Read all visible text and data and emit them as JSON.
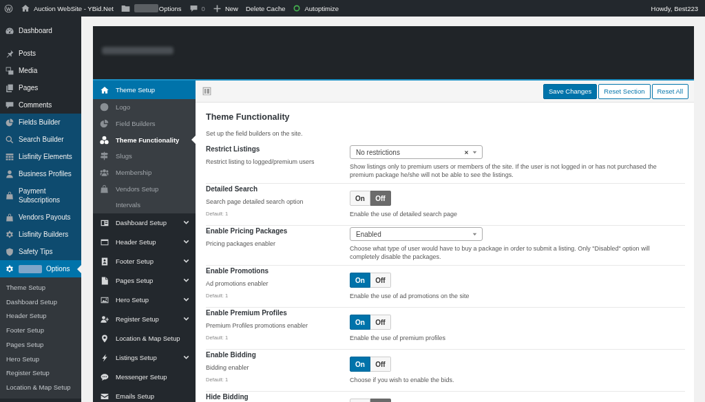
{
  "admin_bar": {
    "site_name": "Auction WebSite - YBid.Net",
    "options": {
      "label": "Options",
      "redacted": true
    },
    "comment_count": "0",
    "new_label": "New",
    "delete_cache": "Delete Cache",
    "autoptimize": "Autoptimize",
    "greeting": "Howdy, Best223"
  },
  "admin_menu": {
    "sections": [
      {
        "kind": "core",
        "items": [
          {
            "label": "Dashboard",
            "selected": false,
            "redacted": false
          }
        ]
      },
      {
        "kind": "core",
        "items": [
          {
            "label": "Posts",
            "selected": false,
            "redacted": false
          },
          {
            "label": "Media",
            "selected": false,
            "redacted": false
          },
          {
            "label": "Pages",
            "selected": false,
            "redacted": false
          },
          {
            "label": "Comments",
            "selected": false,
            "redacted": false
          }
        ]
      },
      {
        "kind": "plugin",
        "items": [
          {
            "label": "Fields Builder",
            "selected": false,
            "redacted": false
          },
          {
            "label": "Search Builder",
            "selected": false,
            "redacted": false
          },
          {
            "label": "Lisfinity Elements",
            "selected": false,
            "redacted": false
          },
          {
            "label": "Business Profiles",
            "selected": false,
            "redacted": false
          },
          {
            "label": "Payment Subscriptions",
            "selected": false,
            "redacted": false
          },
          {
            "label": "Vendors Payouts",
            "selected": false,
            "redacted": false
          },
          {
            "label": "Lisfinity Builders",
            "selected": false,
            "redacted": false
          },
          {
            "label": "Safety Tips",
            "selected": false,
            "redacted": false
          },
          {
            "label": "Options",
            "selected": true,
            "redacted": true
          }
        ]
      }
    ],
    "submenu": [
      "Theme Setup",
      "Dashboard Setup",
      "Header Setup",
      "Footer Setup",
      "Pages Setup",
      "Hero Setup",
      "Register Setup",
      "Location & Map Setup"
    ]
  },
  "options_nav": {
    "items": [
      {
        "label": "Theme Setup",
        "kind": "group",
        "selected": true,
        "expanded": true,
        "children": [
          {
            "label": "Logo",
            "selected": false
          },
          {
            "label": "Field Builders",
            "selected": false
          },
          {
            "label": "Theme Functionality",
            "selected": true
          },
          {
            "label": "Slugs",
            "selected": false
          },
          {
            "label": "Membership",
            "selected": false
          },
          {
            "label": "Vendors Setup",
            "selected": false
          },
          {
            "label": "Intervals",
            "selected": false
          }
        ]
      },
      {
        "label": "Dashboard Setup",
        "kind": "group",
        "selected": false,
        "expanded": false
      },
      {
        "label": "Header Setup",
        "kind": "group",
        "selected": false,
        "expanded": false
      },
      {
        "label": "Footer Setup",
        "kind": "group",
        "selected": false,
        "expanded": false
      },
      {
        "label": "Pages Setup",
        "kind": "group",
        "selected": false,
        "expanded": false
      },
      {
        "label": "Hero Setup",
        "kind": "group",
        "selected": false,
        "expanded": false
      },
      {
        "label": "Register Setup",
        "kind": "group",
        "selected": false,
        "expanded": false
      },
      {
        "label": "Location & Map Setup",
        "kind": "link",
        "selected": false
      },
      {
        "label": "Listings Setup",
        "kind": "group",
        "selected": false,
        "expanded": false
      },
      {
        "label": "Messenger Setup",
        "kind": "link",
        "selected": false
      },
      {
        "label": "Emails Setup",
        "kind": "link",
        "selected": false
      }
    ]
  },
  "toolbar": {
    "buttons": [
      {
        "label": "Save Changes",
        "kind": "primary"
      },
      {
        "label": "Reset Section",
        "kind": "secondary"
      },
      {
        "label": "Reset All",
        "kind": "secondary"
      }
    ]
  },
  "section": {
    "title": "Theme Functionality",
    "subtitle": "Set up the field builders on the site.",
    "fields": [
      {
        "kind": "select",
        "title": "Restrict Listings",
        "subtitle": "Restrict listing to logged/premium users",
        "value": "No restrictions",
        "clearable": true,
        "description": "Show listings only to premium users or members of the site. If the user is not logged in or has not purchased the premium package he/she will not be able to see the listings."
      },
      {
        "kind": "switch",
        "title": "Detailed Search",
        "subtitle": "Search page detailed search option",
        "default": "Default: 1",
        "options": [
          {
            "label": "On",
            "selected": false
          },
          {
            "label": "Off",
            "selected": true
          }
        ],
        "description": "Enable the use of detailed search page"
      },
      {
        "kind": "select",
        "title": "Enable Pricing Packages",
        "subtitle": "Pricing packages enabler",
        "value": "Enabled",
        "clearable": false,
        "description": "Choose what type of user would have to buy a package in order to submit a listing. Only \"Disabled\" option will completely disable the packages."
      },
      {
        "kind": "switch",
        "title": "Enable Promotions",
        "subtitle": "Ad promotions enabler",
        "default": "Default: 1",
        "options": [
          {
            "label": "On",
            "selected": true
          },
          {
            "label": "Off",
            "selected": false
          }
        ],
        "description": "Enable the use of ad promotions on the site"
      },
      {
        "kind": "switch",
        "title": "Enable Premium Profiles",
        "subtitle": "Premium Profiles promotions enabler",
        "default": "Default: 1",
        "options": [
          {
            "label": "On",
            "selected": true
          },
          {
            "label": "Off",
            "selected": false
          }
        ],
        "description": "Enable the use of premium profiles"
      },
      {
        "kind": "switch",
        "title": "Enable Bidding",
        "subtitle": "Bidding enabler",
        "default": "Default: 1",
        "options": [
          {
            "label": "On",
            "selected": true
          },
          {
            "label": "Off",
            "selected": false
          }
        ],
        "description": "Choose if you wish to enable the bids."
      },
      {
        "kind": "switch",
        "title": "Hide Bidding",
        "options": [
          {
            "selected": false
          },
          {
            "selected": true
          }
        ]
      }
    ]
  }
}
